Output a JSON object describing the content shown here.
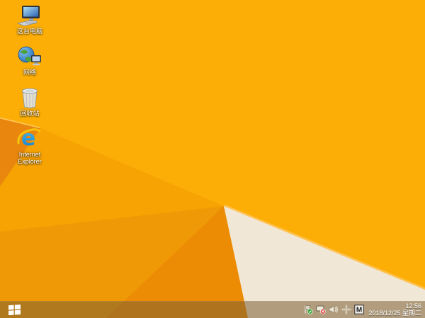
{
  "desktop": {
    "icons": [
      {
        "name": "this-pc",
        "label": "这台电脑"
      },
      {
        "name": "network",
        "label": "网络"
      },
      {
        "name": "recycle-bin",
        "label": "回收站"
      },
      {
        "name": "internet-explorer",
        "label": "Internet Explorer"
      }
    ]
  },
  "taskbar": {
    "start_icon": "windows-logo",
    "tray": {
      "icon_names": [
        "action-center-flag",
        "network-disconnected",
        "volume",
        "safely-remove-hardware",
        "input-method"
      ],
      "input_method_label": "M",
      "clock": {
        "time": "12:56",
        "date": "2018/12/25 星期二"
      }
    }
  },
  "wallpaper": {
    "description": "windows-8.1-default-folded-paper",
    "colors": {
      "main": "#FCAE06",
      "wedge": "#E8860D",
      "wedge_edge": "#FFC95B",
      "facet2": "#F6A303",
      "facet3": "#F09906",
      "facet4": "#EC8B04",
      "white_fold": "#F1E7D7",
      "fold_rim": "#FFC14F"
    }
  }
}
